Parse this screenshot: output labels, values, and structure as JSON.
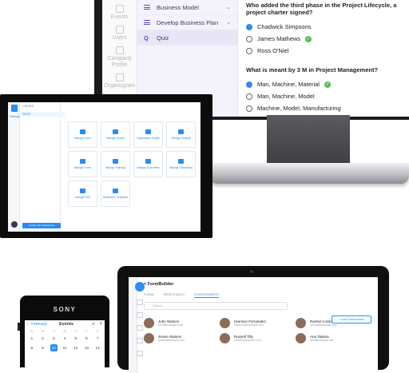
{
  "colors": {
    "accent": "#5a50c8",
    "primary_blue": "#2f8cf5",
    "correct": "#4fc24f"
  },
  "back_device": {
    "rail": [
      {
        "icon": "calendar-icon",
        "label": "Events"
      },
      {
        "icon": "users-icon",
        "label": "Users"
      },
      {
        "icon": "building-icon",
        "label": "Company Profile"
      },
      {
        "icon": "org-chart-icon",
        "label": "Organogram"
      }
    ],
    "menu": [
      {
        "label": "Business Model",
        "icon": "list-icon",
        "chevron": "⌄"
      },
      {
        "label": "Develop Business Plan",
        "icon": "list-icon",
        "chevron": "⌄"
      },
      {
        "label": "Quiz",
        "icon": "Q"
      }
    ],
    "quiz": {
      "q1": "Who added the third phase in the Project Lifecycle, a project charter signed?",
      "q1_options": [
        {
          "label": "Chadwick Simpsons",
          "selected": true,
          "correct": false
        },
        {
          "label": "James Mathews",
          "selected": false,
          "correct": true
        },
        {
          "label": "Ross O'Niel",
          "selected": false,
          "correct": false
        }
      ],
      "q2": "What is meant by 3 M in Project Management?",
      "q2_options": [
        {
          "label": "Man, Machine, Material",
          "selected": true,
          "correct": true
        },
        {
          "label": "Man, Machine, Model",
          "selected": false,
          "correct": false
        },
        {
          "label": "Machine, Model, Manufacturing",
          "selected": false,
          "correct": false
        }
      ]
    }
  },
  "tablet": {
    "breadcrumb": "< BOSS",
    "nav_label": "Settings",
    "list_selected": "BOSS",
    "list_button": "Create Sub Organization",
    "tiles": [
      "Manage Users",
      "Manage Groups",
      "Organization Details",
      "Manage Settings",
      "Manage Forms",
      "Manage Trainings",
      "Manage Documents",
      "Manage Onboarding",
      "Manage SSO",
      "Notification Templates"
    ]
  },
  "front_tablet": {
    "title": "< FormBuilder",
    "tabs": [
      "FORM",
      "RESPONSES",
      "SUBSCRIBERS"
    ],
    "active_tab": "SUBSCRIBERS",
    "search_placeholder": "Search",
    "add_button": "+ Add Subscribers",
    "subscribers": [
      {
        "name": "John Watson",
        "email": "john@example.com"
      },
      {
        "name": "Harrison Fernandez",
        "email": "harrison@example.com"
      },
      {
        "name": "Rachel Cortez",
        "email": "rachel@example.com"
      },
      {
        "name": "Jessie Watson",
        "email": "jessie@example.com"
      },
      {
        "name": "Russell Tilly",
        "email": "russell@example.com"
      },
      {
        "name": "Ana Tatiana",
        "email": "ana@example.com"
      }
    ]
  },
  "phone": {
    "brand": "SONY",
    "back_label": "February",
    "title": "Events",
    "days": [
      "S",
      "M",
      "T",
      "W",
      "T",
      "F",
      "S"
    ],
    "dates": [
      "1",
      "2",
      "3",
      "4",
      "5",
      "6",
      "7",
      "8",
      "9",
      "10",
      "11",
      "12",
      "13",
      "14"
    ],
    "selected_date": "10"
  }
}
